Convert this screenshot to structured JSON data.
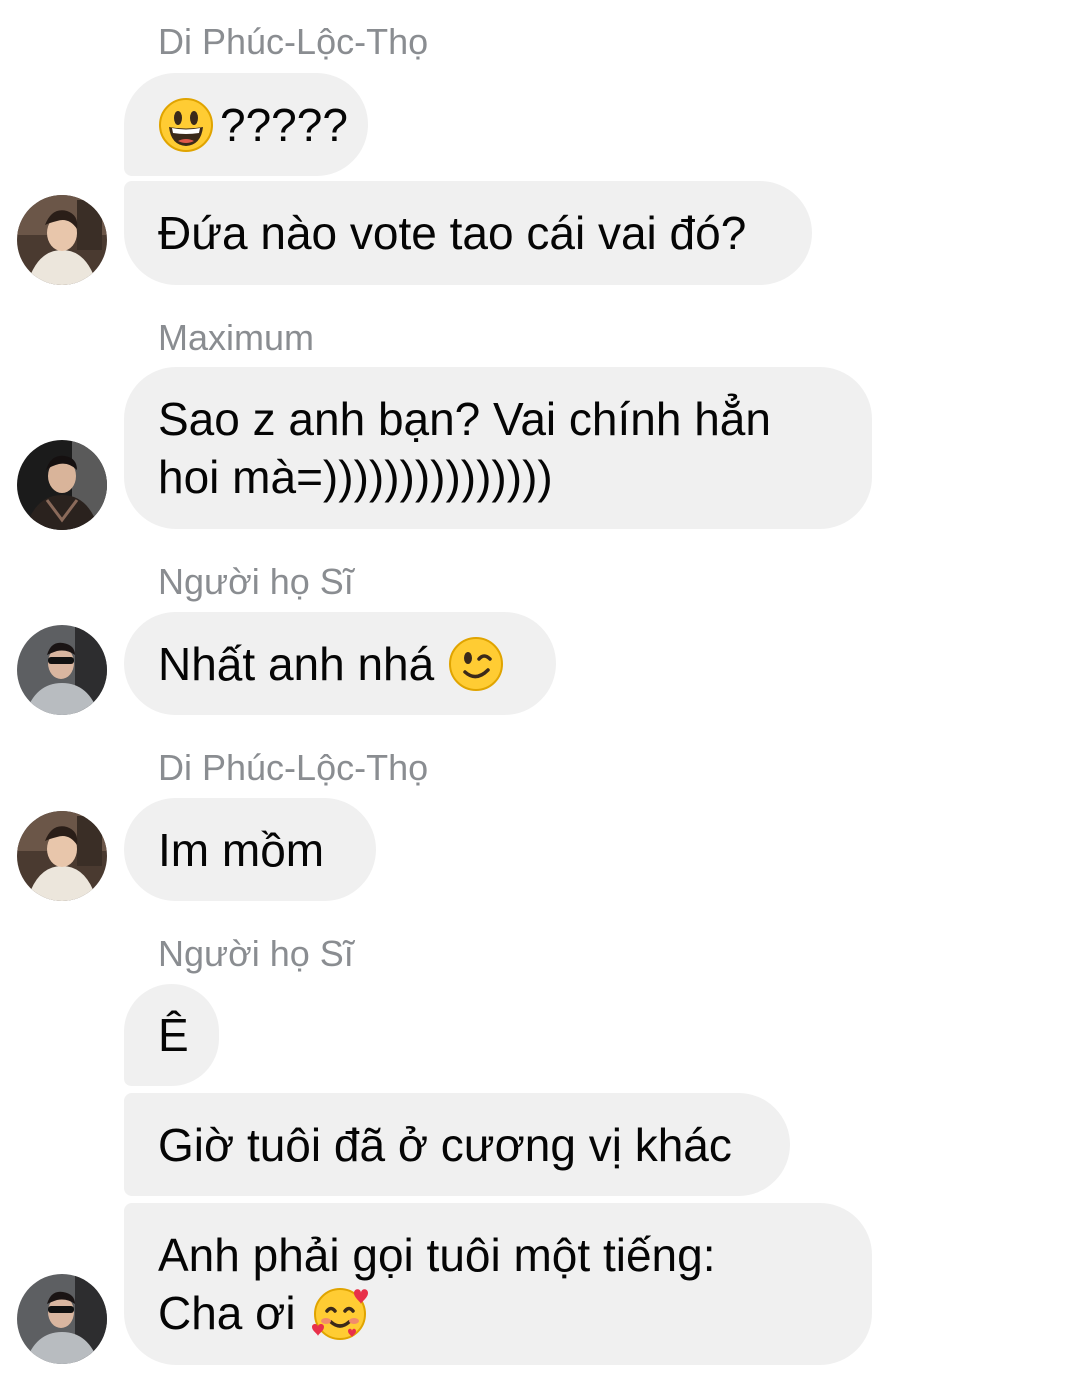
{
  "messages": [
    {
      "sender": "Di Phúc-Lộc-Thọ",
      "lines": [
        "?????",
        "Đứa nào vote tao cái vai đó?"
      ]
    },
    {
      "sender": "Maximum",
      "lines": [
        "Sao z anh bạn? Vai chính hẳn",
        "hoi mà=)))))))))))))))"
      ]
    },
    {
      "sender": "Người họ Sĩ",
      "lines": [
        "Nhất anh nhá"
      ]
    },
    {
      "sender": "Di Phúc-Lộc-Thọ",
      "lines": [
        "Im mồm"
      ]
    },
    {
      "sender": "Người họ Sĩ",
      "lines": [
        "Ê",
        "Giờ tuôi đã ở cương vị khác",
        "Anh phải gọi tuôi một tiếng:",
        "Cha ơi"
      ]
    }
  ],
  "icons": {
    "grinning": "grinning-face-icon",
    "wink": "winking-face-icon",
    "hearts": "smiling-face-with-hearts-icon"
  },
  "colors": {
    "bubble": "#f0f0f0",
    "sender_name": "#8a8d91",
    "text": "#050505"
  }
}
